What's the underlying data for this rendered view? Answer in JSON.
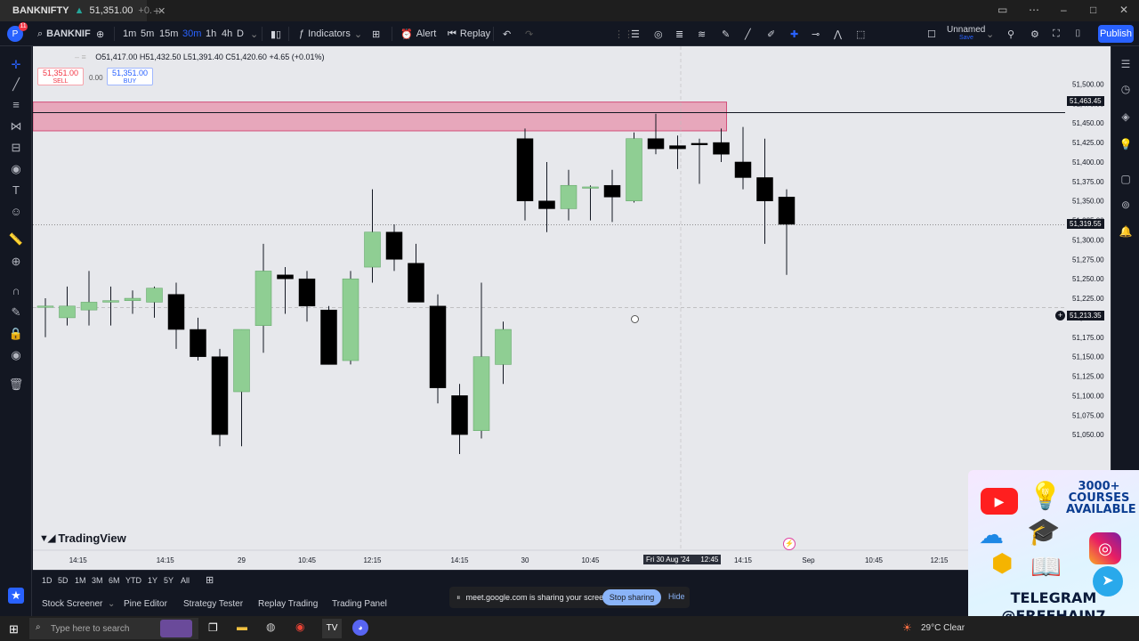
{
  "browser": {
    "tab_title": "BANKNIFTY",
    "tab_price": "51,351.00",
    "tab_change": "+0."
  },
  "toolbar": {
    "avatar_letter": "P",
    "avatar_badge": "11",
    "symbol": "BANKNIF",
    "intervals": [
      "1m",
      "5m",
      "15m",
      "30m",
      "1h",
      "4h",
      "D"
    ],
    "active_interval": "30m",
    "indicators_label": "Indicators",
    "alert_label": "Alert",
    "replay_label": "Replay",
    "layout_name": "Unnamed",
    "layout_sub": "Save",
    "publish_label": "Publish"
  },
  "legend": {
    "ohlc": "O51,417.00  H51,432.50  L51,391.40  C51,420.60  +4.65 (+0.01%)",
    "sell_price": "51,351.00",
    "sell_label": "SELL",
    "spread": "0.00",
    "buy_price": "51,351.00",
    "buy_label": "BUY"
  },
  "price_tags": {
    "zone_line": "51,463.45",
    "last_price": "51,319.55",
    "crosshair": "51,213.35"
  },
  "branding": {
    "logo_text": "TradingView"
  },
  "crosshair_date": "Fri 30 Aug '24",
  "crosshair_time": "12:45",
  "chart_data": {
    "type": "candlestick",
    "y_ticks": [
      "51,500.00",
      "51,475.00",
      "51,450.00",
      "51,425.00",
      "51,400.00",
      "51,375.00",
      "51,350.00",
      "51,325.00",
      "51,300.00",
      "51,275.00",
      "51,250.00",
      "51,225.00",
      "51,200.00",
      "51,175.00",
      "51,150.00",
      "51,125.00",
      "51,100.00",
      "51,075.00",
      "51,050.00"
    ],
    "ylim": [
      51025,
      51520
    ],
    "x_ticks": [
      {
        "label": "14:15",
        "i": 1.5
      },
      {
        "label": "14:15",
        "i": 5.5
      },
      {
        "label": "29",
        "i": 9
      },
      {
        "label": "10:45",
        "i": 12
      },
      {
        "label": "12:15",
        "i": 15
      },
      {
        "label": "14:15",
        "i": 19
      },
      {
        "label": "30",
        "i": 22
      },
      {
        "label": "10:45",
        "i": 25
      },
      {
        "label": "14:15",
        "i": 32
      },
      {
        "label": "Sep",
        "i": 35
      },
      {
        "label": "10:45",
        "i": 38
      },
      {
        "label": "12:15",
        "i": 41
      }
    ],
    "supply_zone": {
      "top": 51477,
      "bottom": 51440,
      "to_index": 31
    },
    "zone_line_value": 51463.45,
    "last_price_value": 51319.55,
    "crosshair_value": 51213.35,
    "candles": [
      {
        "o": 51215,
        "h": 51225,
        "l": 51175,
        "c": 51215
      },
      {
        "o": 51200,
        "h": 51240,
        "l": 51190,
        "c": 51215
      },
      {
        "o": 51210,
        "h": 51260,
        "l": 51190,
        "c": 51220
      },
      {
        "o": 51220,
        "h": 51240,
        "l": 51190,
        "c": 51222
      },
      {
        "o": 51222,
        "h": 51235,
        "l": 51205,
        "c": 51225
      },
      {
        "o": 51220,
        "h": 51240,
        "l": 51200,
        "c": 51238
      },
      {
        "o": 51230,
        "h": 51245,
        "l": 51160,
        "c": 51185
      },
      {
        "o": 51185,
        "h": 51200,
        "l": 51145,
        "c": 51150
      },
      {
        "o": 51150,
        "h": 51160,
        "l": 51035,
        "c": 51050
      },
      {
        "o": 51105,
        "h": 51185,
        "l": 51035,
        "c": 51185
      },
      {
        "o": 51190,
        "h": 51295,
        "l": 51155,
        "c": 51260
      },
      {
        "o": 51255,
        "h": 51265,
        "l": 51205,
        "c": 51250
      },
      {
        "o": 51250,
        "h": 51260,
        "l": 51195,
        "c": 51215
      },
      {
        "o": 51210,
        "h": 51215,
        "l": 51140,
        "c": 51140
      },
      {
        "o": 51145,
        "h": 51260,
        "l": 51140,
        "c": 51250
      },
      {
        "o": 51265,
        "h": 51365,
        "l": 51245,
        "c": 51310
      },
      {
        "o": 51310,
        "h": 51320,
        "l": 51260,
        "c": 51275
      },
      {
        "o": 51270,
        "h": 51295,
        "l": 51220,
        "c": 51220
      },
      {
        "o": 51215,
        "h": 51230,
        "l": 51090,
        "c": 51110
      },
      {
        "o": 51100,
        "h": 51115,
        "l": 51025,
        "c": 51050
      },
      {
        "o": 51055,
        "h": 51245,
        "l": 51045,
        "c": 51150
      },
      {
        "o": 51140,
        "h": 51195,
        "l": 51115,
        "c": 51185
      },
      {
        "o": 51430,
        "h": 51443,
        "l": 51325,
        "c": 51350
      },
      {
        "o": 51350,
        "h": 51400,
        "l": 51310,
        "c": 51340
      },
      {
        "o": 51340,
        "h": 51390,
        "l": 51325,
        "c": 51370
      },
      {
        "o": 51368,
        "h": 51370,
        "l": 51325,
        "c": 51368
      },
      {
        "o": 51370,
        "h": 51390,
        "l": 51323,
        "c": 51355
      },
      {
        "o": 51350,
        "h": 51438,
        "l": 51348,
        "c": 51430
      },
      {
        "o": 51430,
        "h": 51462,
        "l": 51410,
        "c": 51417
      },
      {
        "o": 51421,
        "h": 51434,
        "l": 51391,
        "c": 51417
      },
      {
        "o": 51424,
        "h": 51430,
        "l": 51372,
        "c": 51422
      },
      {
        "o": 51425,
        "h": 51443,
        "l": 51400,
        "c": 51410
      },
      {
        "o": 51400,
        "h": 51445,
        "l": 51365,
        "c": 51380
      },
      {
        "o": 51380,
        "h": 51430,
        "l": 51295,
        "c": 51350
      },
      {
        "o": 51355,
        "h": 51365,
        "l": 51255,
        "c": 51320
      }
    ]
  },
  "range_bar": [
    "1D",
    "5D",
    "1M",
    "3M",
    "6M",
    "YTD",
    "1Y",
    "5Y",
    "All"
  ],
  "bottom_tabs": [
    "Stock Screener",
    "Pine Editor",
    "Strategy Tester",
    "Replay Trading",
    "Trading Panel"
  ],
  "share_notice": {
    "text": "meet.google.com is sharing your screen.",
    "stop_label": "Stop sharing",
    "hide_label": "Hide"
  },
  "taskbar": {
    "search_placeholder": "Type here to search",
    "weather": "29°C  Clear"
  },
  "promo": {
    "headline": "3000+ COURSES AVAILABLE",
    "telegram": "TELEGRAM",
    "handle": "@FREEHAIN7"
  },
  "colors": {
    "bull_body": "#8fce93",
    "bear_body": "#000000",
    "zone_fill": "#e8a0b6",
    "zone_stroke": "#d0406e",
    "chart_bg": "#e7e8ec",
    "accent": "#2962ff"
  }
}
